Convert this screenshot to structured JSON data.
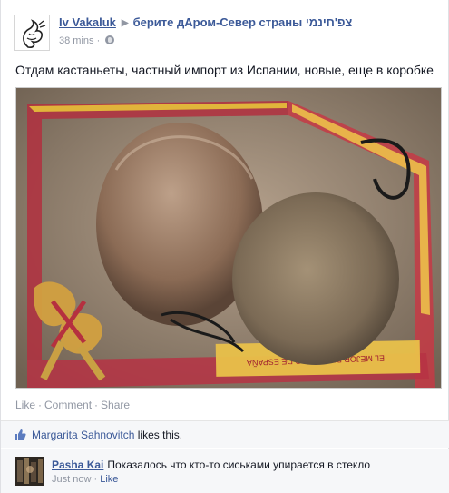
{
  "post": {
    "author": "Iv Vakaluk",
    "group": "берите дАром-Север страны צפ'חינמי",
    "time": "38 mins",
    "separator": "·",
    "privacy_icon": "globe-icon",
    "text": "Отдам кастаньеты, частный импорт из Испании, новые, еще в коробке",
    "photo_box_text": "EL MEJOR RECUERDO DE ESPAÑA"
  },
  "actions": {
    "like": "Like",
    "comment": "Comment",
    "share": "Share",
    "dot": "·"
  },
  "likes": {
    "icon": "thumbs-up-icon",
    "liker": "Margarita Sahnovitch",
    "suffix": "likes this."
  },
  "comment": {
    "author": "Pasha Kai",
    "text": "Показалось что кто-то сиськами упирается в стекло",
    "time": "Just now",
    "dot": "·",
    "like": "Like"
  },
  "colors": {
    "link": "#3b5998",
    "meta": "#9197a3",
    "box_red": "#c0283a",
    "box_yellow": "#f0c419"
  }
}
